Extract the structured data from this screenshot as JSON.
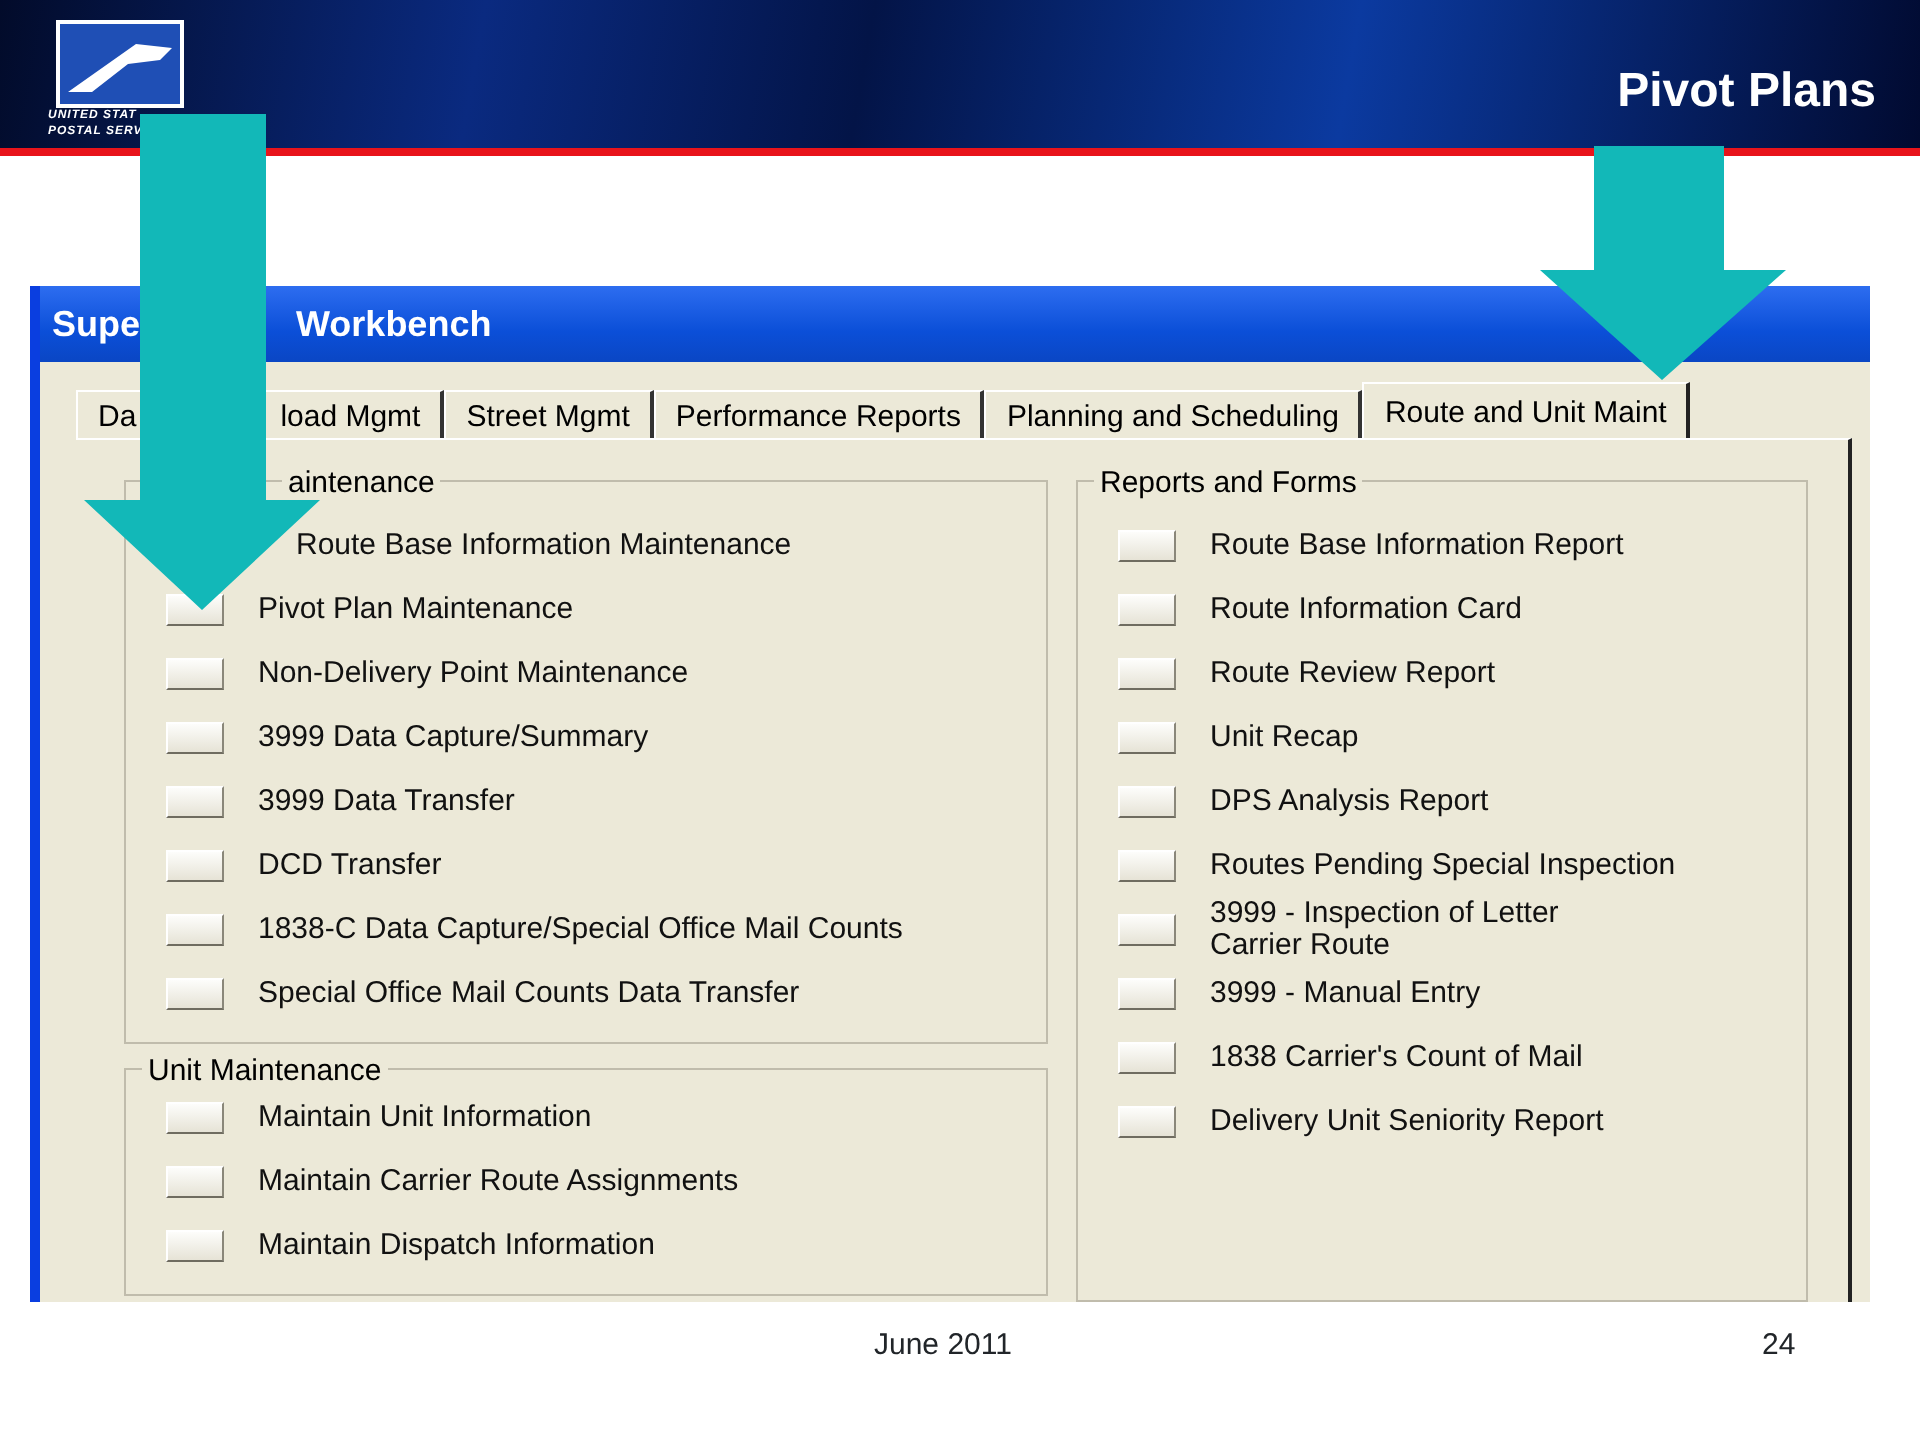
{
  "slide": {
    "logo_lines": [
      "UNITED STAT",
      "POSTAL SERV"
    ],
    "title": "Pivot Plans",
    "footer_date": "June 2011",
    "page_number": "24"
  },
  "window": {
    "title_parts": [
      "Supe",
      "Workbench"
    ]
  },
  "tabs": [
    {
      "label_parts": [
        "Da",
        "load Mgmt"
      ],
      "selected": false
    },
    {
      "label_parts": [
        "Street Mgmt"
      ],
      "selected": false
    },
    {
      "label_parts": [
        "Performance Reports"
      ],
      "selected": false
    },
    {
      "label_parts": [
        "Planning and Scheduling"
      ],
      "selected": false
    },
    {
      "label_parts": [
        "Route and Unit Maint"
      ],
      "selected": true
    }
  ],
  "groups": [
    {
      "title": "aintenance",
      "hidden_first_button": true,
      "items": [
        "Route Base Information Maintenance",
        "Pivot Plan Maintenance",
        "Non-Delivery Point Maintenance",
        "3999 Data Capture/Summary",
        "3999 Data Transfer",
        "DCD Transfer",
        "1838-C Data Capture/Special Office Mail Counts",
        "Special Office Mail Counts Data Transfer"
      ]
    },
    {
      "title": "Unit Maintenance",
      "items": [
        "Maintain Unit Information",
        "Maintain Carrier Route Assignments",
        "Maintain Dispatch Information"
      ]
    },
    {
      "title": "Reports and Forms",
      "items": [
        "Route Base Information Report",
        "Route Information Card",
        "Route Review Report",
        "Unit Recap",
        "DPS Analysis Report",
        "Routes Pending Special Inspection",
        "3999 - Inspection of Letter Carrier Route",
        "3999 - Manual Entry",
        "1838 Carrier's Count of Mail",
        "Delivery Unit Seniority Report"
      ]
    }
  ]
}
